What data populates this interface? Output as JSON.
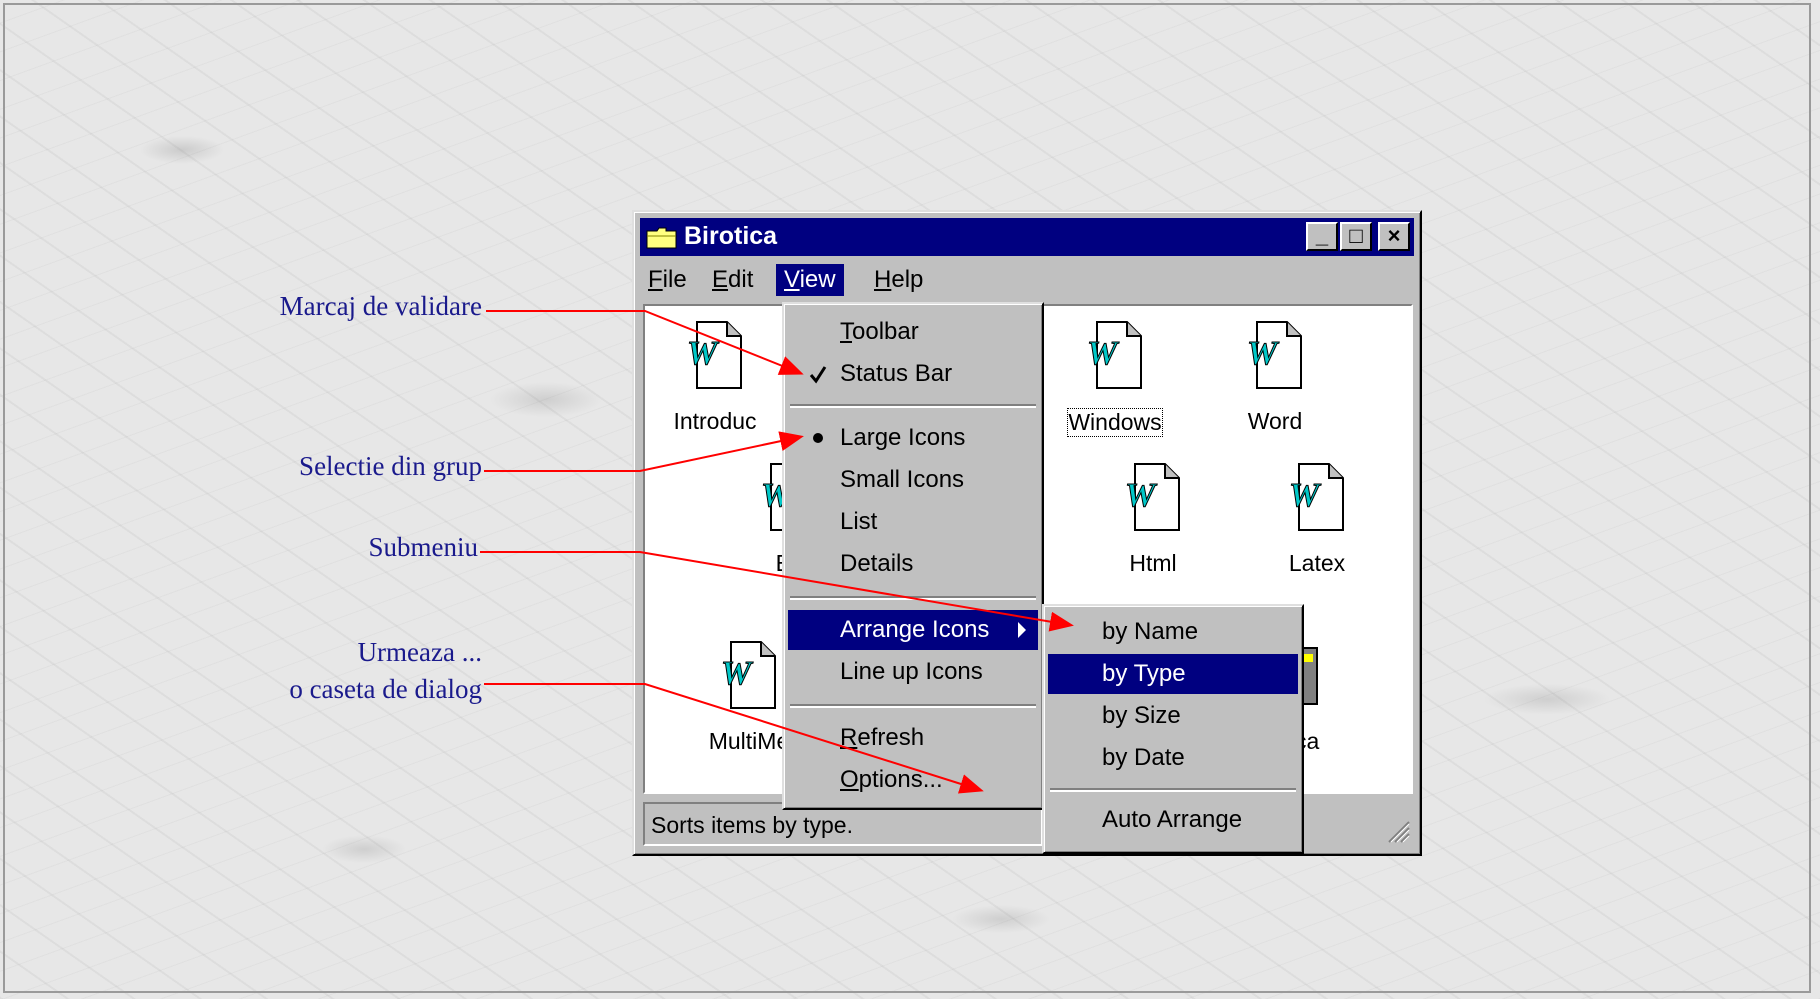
{
  "callouts": {
    "validation_mark": "Marcaj de validare",
    "group_selection": "Selectie din grup",
    "submenu": "Submeniu",
    "followed_line1": "Urmeaza ...",
    "followed_line2": "o caseta de dialog"
  },
  "window": {
    "title": "Birotica",
    "buttons": {
      "minimize": "_",
      "maximize": "□",
      "close": "×"
    }
  },
  "menubar": [
    {
      "label": "File",
      "accel": "F"
    },
    {
      "label": "Edit",
      "accel": "E"
    },
    {
      "label": "View",
      "accel": "V"
    },
    {
      "label": "Help",
      "accel": "H"
    }
  ],
  "files": {
    "introduc": "Introduc",
    "windows": "Windows",
    "word": "Word",
    "ex": "Ex",
    "html": "Html",
    "latex": "Latex",
    "multimedia": "MultiMe",
    "ca": "ca"
  },
  "view_menu": {
    "toolbar": "Toolbar",
    "status_bar": "Status Bar",
    "large_icons": "Large Icons",
    "small_icons": "Small Icons",
    "list": "List",
    "details": "Details",
    "arrange_icons": "Arrange Icons",
    "line_up_icons": "Line up Icons",
    "refresh": "Refresh",
    "options": "Options..."
  },
  "arrange_menu": {
    "by_name": "by Name",
    "by_type": "by Type",
    "by_size": "by Size",
    "by_date": "by Date",
    "auto_arrange": "Auto Arrange"
  },
  "status": "Sorts items by type.",
  "colors": {
    "title_bg": "#000080",
    "face": "#c0c0c0",
    "arrow": "#ff0000",
    "callout": "#1a1a8c"
  }
}
